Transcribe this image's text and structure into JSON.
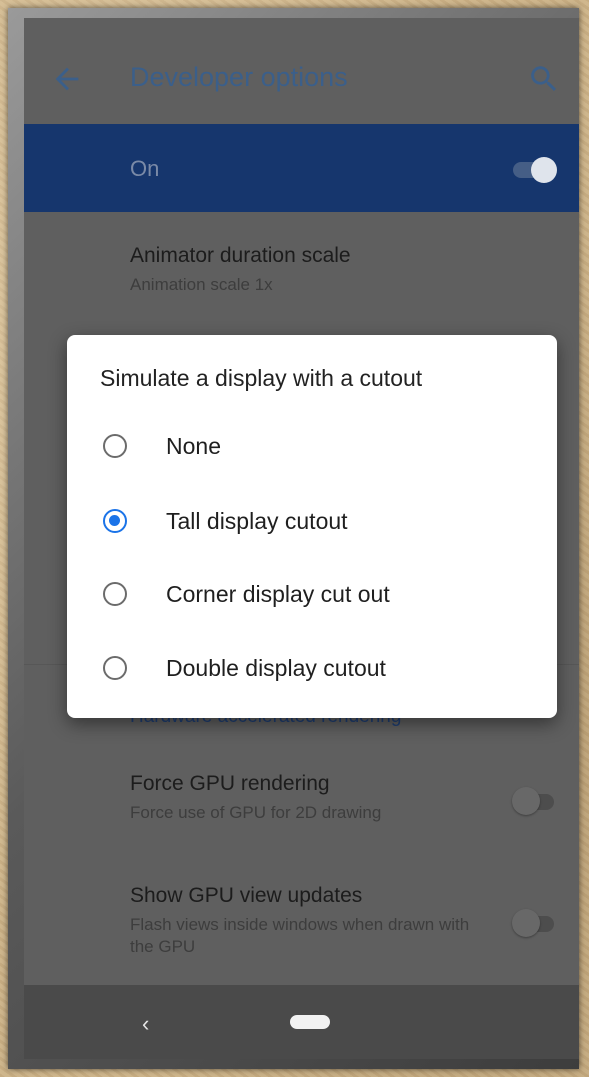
{
  "app_bar": {
    "title": "Developer options",
    "back_icon": "arrow-left-icon",
    "search_icon": "search-icon"
  },
  "master_switch": {
    "label": "On",
    "checked": true
  },
  "settings": [
    {
      "title": "Animator duration scale",
      "summary": "Animation scale 1x"
    },
    {
      "title": "Force GPU rendering",
      "summary": "Force use of GPU for 2D drawing",
      "checked": false
    },
    {
      "title": "Show GPU view updates",
      "summary": "Flash views inside windows when drawn with the GPU",
      "checked": false
    }
  ],
  "section_header": "Hardware accelerated rendering",
  "dialog": {
    "title": "Simulate a display with a cutout",
    "options": [
      {
        "label": "None",
        "selected": false
      },
      {
        "label": "Tall display cutout",
        "selected": true
      },
      {
        "label": "Corner display cut out",
        "selected": false
      },
      {
        "label": "Double display cutout",
        "selected": false
      }
    ]
  },
  "nav_bar": {
    "back_glyph": "‹",
    "home_icon": "home-pill-icon"
  },
  "colors": {
    "accent": "#1a73e8",
    "header_blue": "#16366d",
    "scrim_gray": "#5f5f5f"
  }
}
